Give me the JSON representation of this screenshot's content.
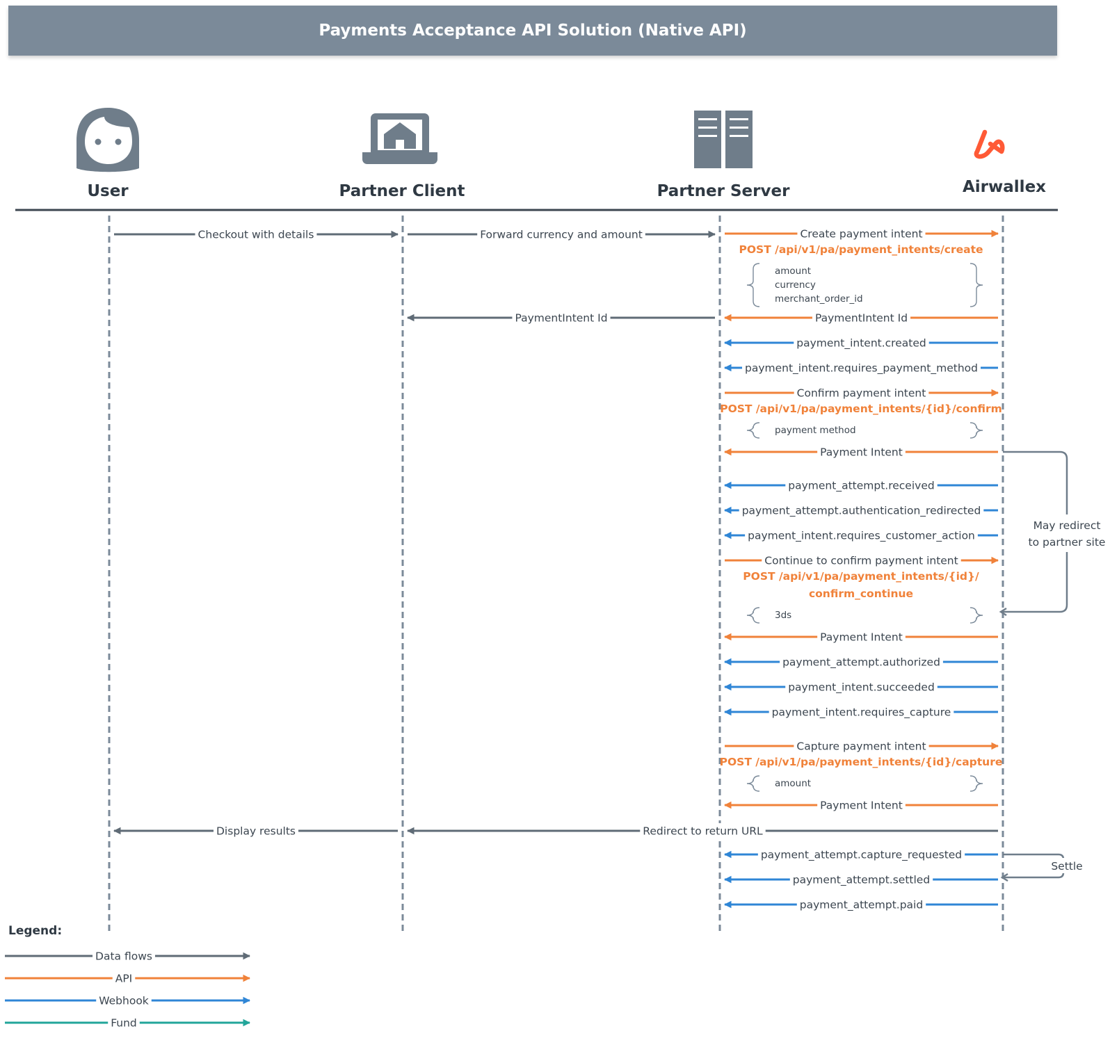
{
  "title": "Payments Acceptance API Solution (Native API)",
  "colors": {
    "data": "#5f6b76",
    "api": "#f0823a",
    "webhook": "#2f86d6",
    "fund": "#22a59a",
    "lifeline": "#7b8a99",
    "brand": "#ff5a36"
  },
  "actors": [
    {
      "id": "user",
      "label": "User",
      "icon": "user-face-icon"
    },
    {
      "id": "client",
      "label": "Partner Client",
      "icon": "laptop-home-icon"
    },
    {
      "id": "server",
      "label": "Partner Server",
      "icon": "server-rack-icon"
    },
    {
      "id": "airwallex",
      "label": "Airwallex",
      "icon": "airwallex-logo-icon"
    }
  ],
  "messages": [
    {
      "from": "user",
      "to": "client",
      "label": "Checkout with details",
      "kind": "data"
    },
    {
      "from": "client",
      "to": "server",
      "label": "Forward currency and amount",
      "kind": "data"
    },
    {
      "from": "server",
      "to": "airwallex",
      "label": "Create payment intent",
      "kind": "api",
      "endpoint": [
        "POST /api/v1/pa/payment_intents/create"
      ],
      "params": [
        "amount",
        "currency",
        "merchant_order_id"
      ]
    },
    {
      "from": "airwallex",
      "to": "server",
      "label": "PaymentIntent Id",
      "kind": "api"
    },
    {
      "from": "server",
      "to": "client",
      "label": "PaymentIntent Id",
      "kind": "data"
    },
    {
      "from": "airwallex",
      "to": "server",
      "label": "payment_intent.created",
      "kind": "webhook"
    },
    {
      "from": "airwallex",
      "to": "server",
      "label": "payment_intent.requires_payment_method",
      "kind": "webhook"
    },
    {
      "from": "server",
      "to": "airwallex",
      "label": "Confirm payment intent",
      "kind": "api",
      "endpoint": [
        "POST /api/v1/pa/payment_intents/{id}/confirm"
      ],
      "params": [
        "payment method"
      ]
    },
    {
      "from": "airwallex",
      "to": "server",
      "label": "Payment Intent",
      "kind": "api"
    },
    {
      "from": "airwallex",
      "to": "server",
      "label": "payment_attempt.received",
      "kind": "webhook"
    },
    {
      "from": "airwallex",
      "to": "server",
      "label": "payment_attempt.authentication_redirected",
      "kind": "webhook"
    },
    {
      "from": "airwallex",
      "to": "server",
      "label": "payment_intent.requires_customer_action",
      "kind": "webhook"
    },
    {
      "from": "server",
      "to": "airwallex",
      "label": "Continue to confirm payment intent",
      "kind": "api",
      "endpoint": [
        "POST /api/v1/pa/payment_intents/{id}/",
        "confirm_continue"
      ],
      "params": [
        "3ds"
      ]
    },
    {
      "from": "airwallex",
      "to": "server",
      "label": "Payment Intent",
      "kind": "api"
    },
    {
      "from": "airwallex",
      "to": "server",
      "label": "payment_attempt.authorized",
      "kind": "webhook"
    },
    {
      "from": "airwallex",
      "to": "server",
      "label": "payment_intent.succeeded",
      "kind": "webhook"
    },
    {
      "from": "airwallex",
      "to": "server",
      "label": "payment_intent.requires_capture",
      "kind": "webhook"
    },
    {
      "from": "server",
      "to": "airwallex",
      "label": "Capture payment intent",
      "kind": "api",
      "endpoint": [
        "POST /api/v1/pa/payment_intents/{id}/capture"
      ],
      "params": [
        "amount"
      ]
    },
    {
      "from": "airwallex",
      "to": "server",
      "label": "Payment Intent",
      "kind": "api"
    },
    {
      "from": "airwallex",
      "to": "client",
      "label": "Redirect to return URL",
      "kind": "data"
    },
    {
      "from": "client",
      "to": "user",
      "label": "Display results",
      "kind": "data"
    },
    {
      "from": "airwallex",
      "to": "server",
      "label": "payment_attempt.capture_requested",
      "kind": "webhook"
    },
    {
      "from": "airwallex",
      "to": "server",
      "label": "payment_attempt.settled",
      "kind": "webhook"
    },
    {
      "from": "airwallex",
      "to": "server",
      "label": "payment_attempt.paid",
      "kind": "webhook"
    }
  ],
  "side_notes": {
    "redirect": [
      "May redirect",
      "to partner site"
    ],
    "settle": "Settle"
  },
  "legend": {
    "title": "Legend:",
    "items": [
      {
        "label": "Data flows",
        "kind": "data"
      },
      {
        "label": "API",
        "kind": "api"
      },
      {
        "label": "Webhook",
        "kind": "webhook"
      },
      {
        "label": "Fund",
        "kind": "fund"
      }
    ]
  }
}
